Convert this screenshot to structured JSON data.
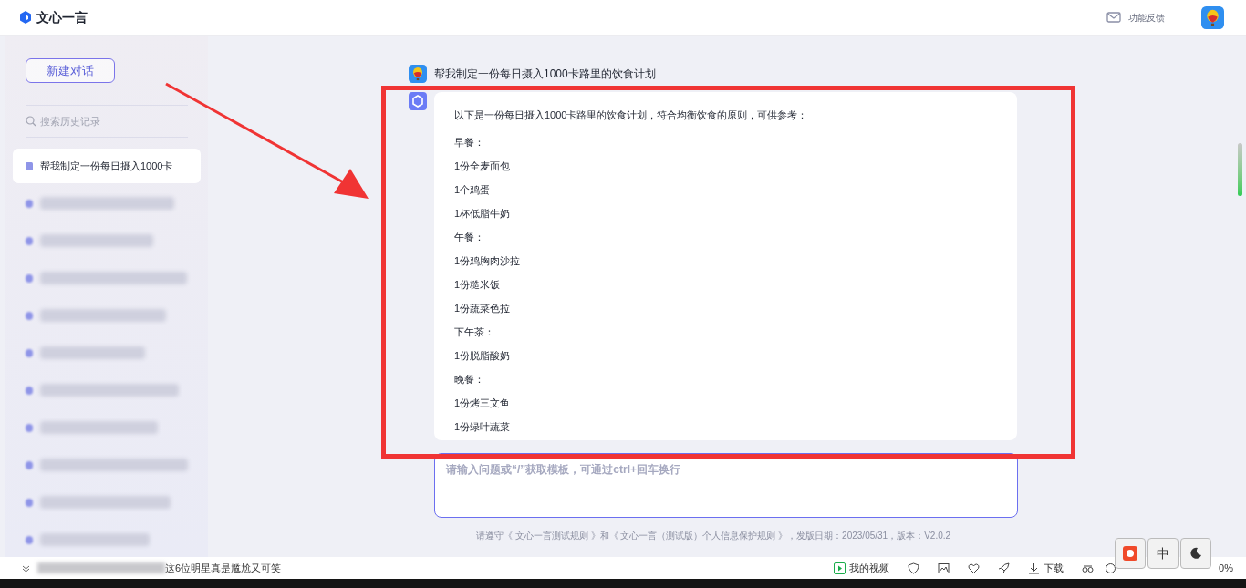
{
  "header": {
    "brand": "文心一言",
    "feedback": "功能反馈"
  },
  "sidebar": {
    "new_chat": "新建对话",
    "search_placeholder": "搜索历史记录",
    "items": [
      {
        "title": "帮我制定一份每日摄入1000卡",
        "selected": true
      },
      {
        "kind": "blurred",
        "selected": false
      },
      {
        "kind": "blurred",
        "selected": false
      },
      {
        "kind": "blurred",
        "selected": false
      },
      {
        "kind": "blurred",
        "selected": false
      },
      {
        "kind": "blurred",
        "selected": false
      },
      {
        "kind": "blurred",
        "selected": false
      },
      {
        "kind": "blurred",
        "selected": false
      },
      {
        "kind": "blurred",
        "selected": false
      },
      {
        "kind": "blurred",
        "selected": false
      },
      {
        "kind": "blurred",
        "selected": false
      }
    ]
  },
  "chat": {
    "question": "帮我制定一份每日摄入1000卡路里的饮食计划",
    "answer_lines": [
      "以下是一份每日摄入1000卡路里的饮食计划，符合均衡饮食的原则，可供参考：",
      "早餐：",
      "1份全麦面包",
      "1个鸡蛋",
      "1杯低脂牛奶",
      "午餐：",
      "1份鸡胸肉沙拉",
      "1份糙米饭",
      "1份蔬菜色拉",
      "下午茶：",
      "1份脱脂酸奶",
      "晚餐：",
      "1份烤三文鱼",
      "1份绿叶蔬菜"
    ]
  },
  "input": {
    "placeholder": "请输入问题或“/”获取模板，可通过ctrl+回车换行"
  },
  "footer": "请遵守《 文心一言测试规则 》和《 文心一言（测试版）个人信息保护规则 》，发版日期：2023/05/31，版本：V2.0.2",
  "status_bar": {
    "news": "这6位明星真是尴尬又可笑",
    "video": "我的视频",
    "download": "下载",
    "zoom": "0%"
  },
  "ime": {
    "mode": "中"
  }
}
